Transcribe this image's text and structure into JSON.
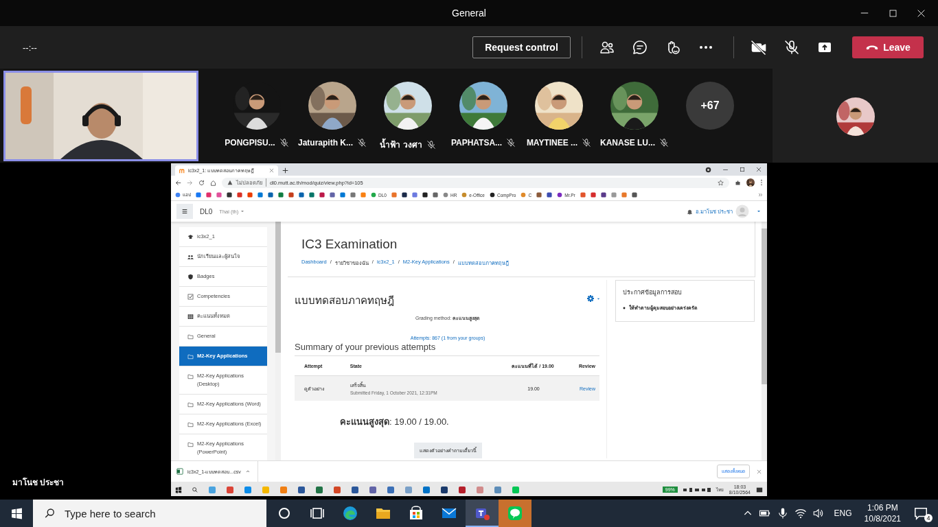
{
  "window": {
    "title": "General"
  },
  "toolbar": {
    "timer": "--:--",
    "request_button": "Request control",
    "leave_button": "Leave"
  },
  "participants": [
    {
      "name": "PONGPISU...",
      "muted": true
    },
    {
      "name": "Jaturapith K...",
      "muted": true
    },
    {
      "name": "น้ำฟ้า วงศา",
      "muted": true
    },
    {
      "name": "PAPHATSA...",
      "muted": true
    },
    {
      "name": "MAYTINEE ...",
      "muted": true
    },
    {
      "name": "KANASE LU...",
      "muted": true
    }
  ],
  "overflow_count": "+67",
  "presenter": {
    "name": "มาโนช ประชา"
  },
  "browser": {
    "tab_title": "ic3x2_1: แบบทดสอบภาคทฤษฎี",
    "security": "ไม่ปลอดภัย",
    "url": "dl0.mutt.ac.th/mod/quiz/view.php?id=105",
    "bookmarks": [
      {
        "kind": "labeled",
        "label": "แอป"
      },
      {
        "kind": "icon"
      },
      {
        "kind": "icon"
      },
      {
        "kind": "icon"
      },
      {
        "kind": "icon"
      },
      {
        "kind": "icon"
      },
      {
        "kind": "icon"
      },
      {
        "kind": "icon"
      },
      {
        "kind": "icon"
      },
      {
        "kind": "icon"
      },
      {
        "kind": "icon"
      },
      {
        "kind": "icon"
      },
      {
        "kind": "icon"
      },
      {
        "kind": "icon"
      },
      {
        "kind": "icon"
      },
      {
        "kind": "icon"
      },
      {
        "kind": "icon"
      },
      {
        "kind": "icon"
      },
      {
        "kind": "labeled",
        "label": "DL0"
      },
      {
        "kind": "icon"
      },
      {
        "kind": "icon"
      },
      {
        "kind": "icon"
      },
      {
        "kind": "icon"
      },
      {
        "kind": "icon"
      },
      {
        "kind": "labeled",
        "label": "HR"
      },
      {
        "kind": "labeled",
        "label": "e-Office"
      },
      {
        "kind": "labeled",
        "label": "CompPro"
      },
      {
        "kind": "labeled",
        "label": "C"
      },
      {
        "kind": "icon"
      },
      {
        "kind": "icon"
      },
      {
        "kind": "labeled",
        "label": "Mr.Pr"
      },
      {
        "kind": "icon"
      },
      {
        "kind": "icon"
      },
      {
        "kind": "icon"
      },
      {
        "kind": "icon"
      },
      {
        "kind": "icon"
      },
      {
        "kind": "icon"
      }
    ]
  },
  "site": {
    "brand": "DL0",
    "language": "Thai (th)",
    "user": "อ.มาโนช ประชา",
    "sidebar": [
      {
        "kind": "course",
        "label": "ic3x2_1",
        "selected": false
      },
      {
        "kind": "participants",
        "label": "นักเรียนและผู้สนใจ",
        "selected": false
      },
      {
        "kind": "badges",
        "label": "Badges",
        "selected": false
      },
      {
        "kind": "competencies",
        "label": "Competencies",
        "selected": false
      },
      {
        "kind": "grades",
        "label": "คะแนนทั้งหมด",
        "selected": false
      },
      {
        "kind": "section",
        "label": "General",
        "selected": false
      },
      {
        "kind": "section",
        "label": "M2-Key Applications",
        "selected": true
      },
      {
        "kind": "section",
        "label": "M2-Key Applications (Desktop)",
        "selected": false
      },
      {
        "kind": "section",
        "label": "M2-Key Applications (Word)",
        "selected": false
      },
      {
        "kind": "section",
        "label": "M2-Key Applications (Excel)",
        "selected": false
      },
      {
        "kind": "section",
        "label": "M2-Key Applications (PowerPoint)",
        "selected": false
      }
    ],
    "page_title": "IC3 Examination",
    "breadcrumb_separator": "/",
    "breadcrumb": [
      {
        "label": "Dashboard",
        "link": true
      },
      {
        "label": "รายวิชาของฉัน",
        "link": false
      },
      {
        "label": "ic3x2_1",
        "link": true
      },
      {
        "label": "M2-Key Applications",
        "link": true
      },
      {
        "label": "แบบทดสอบภาคทฤษฎี",
        "link": true
      }
    ],
    "quiz": {
      "title": "แบบทดสอบภาคทฤษฎี",
      "grading": "Grading method: **คะแนนสูงสุด**",
      "attempts": "Attempts: 867 (1 from your groups)",
      "summary_heading": "Summary of your previous attempts",
      "columns": [
        "Attempt",
        "State",
        "คะแนนที่ได้ / 19.00",
        "Review"
      ],
      "rows": [
        {
          "attempt": "ดูตัวอย่าง",
          "state": "เสร็จสิ้น",
          "submitted": "Submitted Friday, 1 October 2021, 12:31PM",
          "grade": "19.00",
          "review": "Review"
        }
      ],
      "highest": "**คะแนนสูงสุด**: 19.00 / 19.00.",
      "preview_button": "แสดงตัวอย่างคำถามเดี๋ยวนี้"
    },
    "block": {
      "title": "ประกาศข้อมูลการสอบ",
      "items": [
        "ให้ทำตามผู้คุมสอบอย่างเคร่งครัด"
      ]
    }
  },
  "download": {
    "file": "ic3x2_1-แบบทดสอบ...csv",
    "show_all": "แสดงทั้งหมด"
  },
  "inner_taskbar": {
    "battery": "99%",
    "language": "ไทย",
    "time": "18:03",
    "date": "8/10/2564"
  },
  "taskbar": {
    "search": {
      "placeholder": "Type here to search"
    },
    "apps": [
      {
        "kind": "cortana",
        "active": false,
        "flashing": false
      },
      {
        "kind": "taskview",
        "active": false,
        "flashing": false
      },
      {
        "kind": "edge",
        "active": false,
        "flashing": false
      },
      {
        "kind": "explorer",
        "active": false,
        "flashing": false
      },
      {
        "kind": "store",
        "active": false,
        "flashing": false
      },
      {
        "kind": "mail",
        "active": false,
        "flashing": false
      },
      {
        "kind": "teams",
        "active": true,
        "flashing": false
      },
      {
        "kind": "line",
        "active": false,
        "flashing": true
      }
    ],
    "language": "ENG",
    "time": "1:06 PM",
    "date": "10/8/2021",
    "notifications": "4"
  }
}
